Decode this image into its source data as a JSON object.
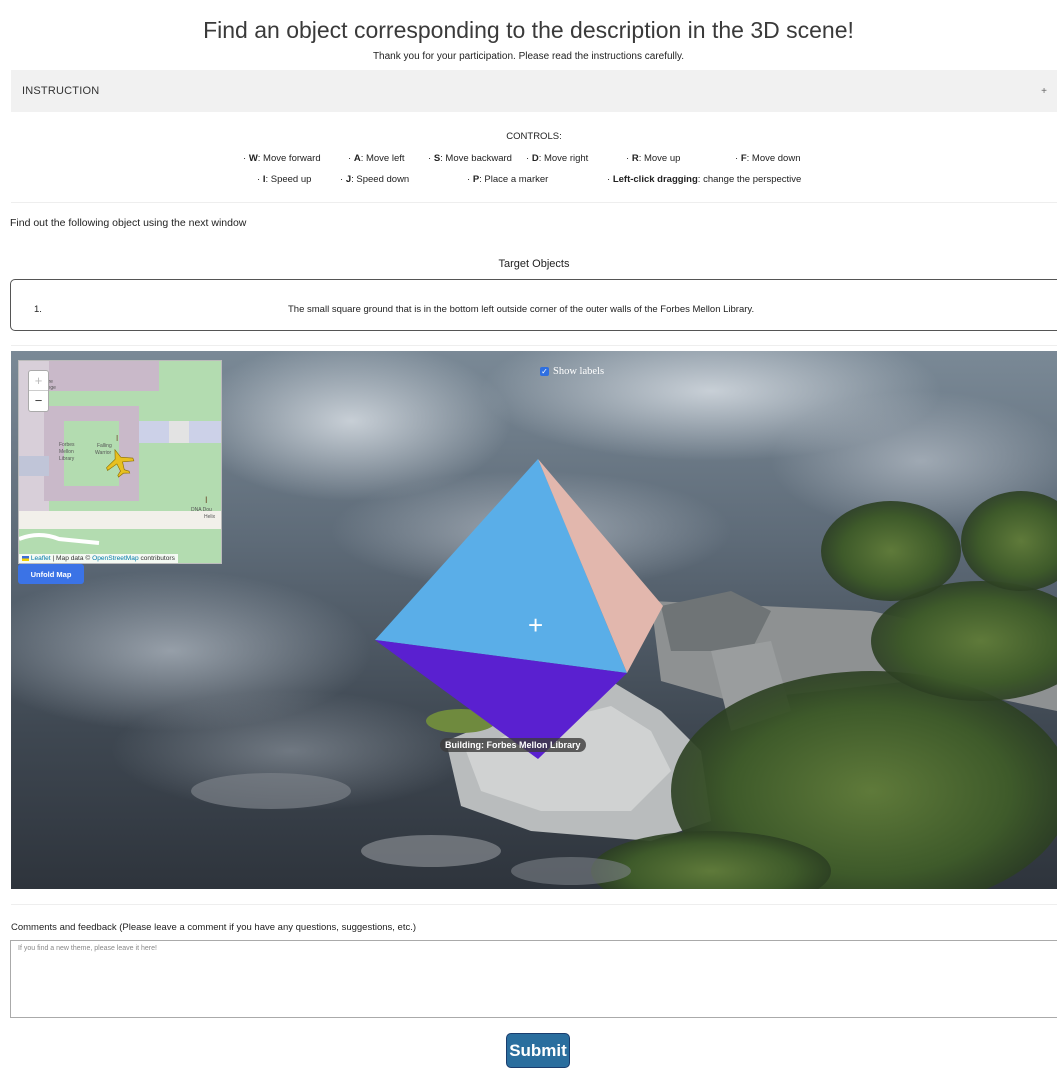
{
  "header": {
    "title": "Find an object corresponding to the description in the 3D scene!",
    "subtitle": "Thank you for your participation. Please read the instructions carefully."
  },
  "instruction": {
    "label": "INSTRUCTION",
    "toggle": "+"
  },
  "controls": {
    "heading": "CONTROLS:",
    "row1": [
      {
        "key": "W",
        "desc": ": Move forward"
      },
      {
        "key": "A",
        "desc": ": Move left"
      },
      {
        "key": "S",
        "desc": ": Move backward"
      },
      {
        "key": "D",
        "desc": ": Move right"
      },
      {
        "key": "R",
        "desc": ": Move up"
      },
      {
        "key": "F",
        "desc": ": Move down"
      }
    ],
    "row2": [
      {
        "key": "I",
        "desc": ": Speed up"
      },
      {
        "key": "J",
        "desc": ": Speed down"
      },
      {
        "key": "P",
        "desc": ": Place a marker"
      },
      {
        "key": "Left-click dragging",
        "desc": ": change the perspective"
      }
    ]
  },
  "find_text": "Find out the following object using the next window",
  "target": {
    "heading": "Target Objects",
    "items": [
      {
        "num": "1.",
        "desc": "The small square ground that is in the bottom left outside corner of the outer walls of the Forbes Mellon Library."
      }
    ]
  },
  "scene": {
    "show_labels": "Show labels",
    "show_labels_checked": true,
    "crosshair": "+",
    "building_label": "Building: Forbes Mellon Library",
    "marker_colors": {
      "left_face": "#5aaee8",
      "right_face": "#e2b7ad",
      "bottom_face": "#5a20d0"
    },
    "minimap": {
      "zoom_in": "+",
      "zoom_out": "−",
      "labels": {
        "clare": "Clare College",
        "forbes": "Forbes Mellon Library",
        "falling": "Falling Warrior",
        "dna": "DNA Double Helix"
      },
      "attribution": {
        "leaflet": "Leaflet",
        "sep": " | Map data © ",
        "osm": "OpenStreetMap",
        "contrib": " contributors"
      },
      "unfold_label": "Unfold Map"
    }
  },
  "feedback": {
    "label": "Comments and feedback (Please leave a comment if you have any questions, suggestions, etc.)",
    "placeholder": "If you find a new theme, please leave it here!"
  },
  "submit_label": "Submit"
}
